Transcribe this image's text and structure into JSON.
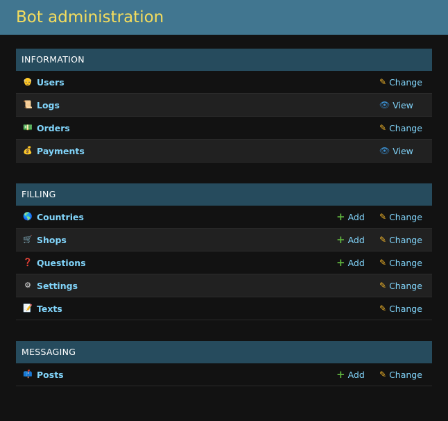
{
  "site": {
    "title": "Bot administration"
  },
  "modules": [
    {
      "caption": "INFORMATION",
      "models": [
        {
          "name": "Users",
          "icon": "person-icon",
          "glyph": "👴",
          "add": null,
          "action": "Change",
          "action_icon": "pencil-icon"
        },
        {
          "name": "Logs",
          "icon": "scroll-icon",
          "glyph": "📜",
          "add": null,
          "action": "View",
          "action_icon": "eye-icon"
        },
        {
          "name": "Orders",
          "icon": "money-icon",
          "glyph": "💵",
          "add": null,
          "action": "Change",
          "action_icon": "pencil-icon"
        },
        {
          "name": "Payments",
          "icon": "money-bag-icon",
          "glyph": "💰",
          "add": null,
          "action": "View",
          "action_icon": "eye-icon"
        }
      ]
    },
    {
      "caption": "FILLING",
      "models": [
        {
          "name": "Countries",
          "icon": "globe-icon",
          "glyph": "🌎",
          "add": "Add",
          "action": "Change",
          "action_icon": "pencil-icon"
        },
        {
          "name": "Shops",
          "icon": "cart-icon",
          "glyph": "🛒",
          "add": "Add",
          "action": "Change",
          "action_icon": "pencil-icon"
        },
        {
          "name": "Questions",
          "icon": "question-icon",
          "glyph": "❓",
          "add": "Add",
          "action": "Change",
          "action_icon": "pencil-icon"
        },
        {
          "name": "Settings",
          "icon": "gear-icon",
          "glyph": "⚙",
          "add": null,
          "action": "Change",
          "action_icon": "pencil-icon"
        },
        {
          "name": "Texts",
          "icon": "document-icon",
          "glyph": "📝",
          "add": null,
          "action": "Change",
          "action_icon": "pencil-icon"
        }
      ]
    },
    {
      "caption": "MESSAGING",
      "models": [
        {
          "name": "Posts",
          "icon": "mailbox-icon",
          "glyph": "📫",
          "add": "Add",
          "action": "Change",
          "action_icon": "pencil-icon"
        }
      ]
    }
  ],
  "colors": {
    "header_bg": "#417690",
    "title": "#f5dd5d",
    "caption_bg": "#264b5d",
    "link": "#81d4fa",
    "add_icon": "#5fb23e",
    "change_icon": "#f0b429",
    "view_icon": "#3b8fd1"
  }
}
